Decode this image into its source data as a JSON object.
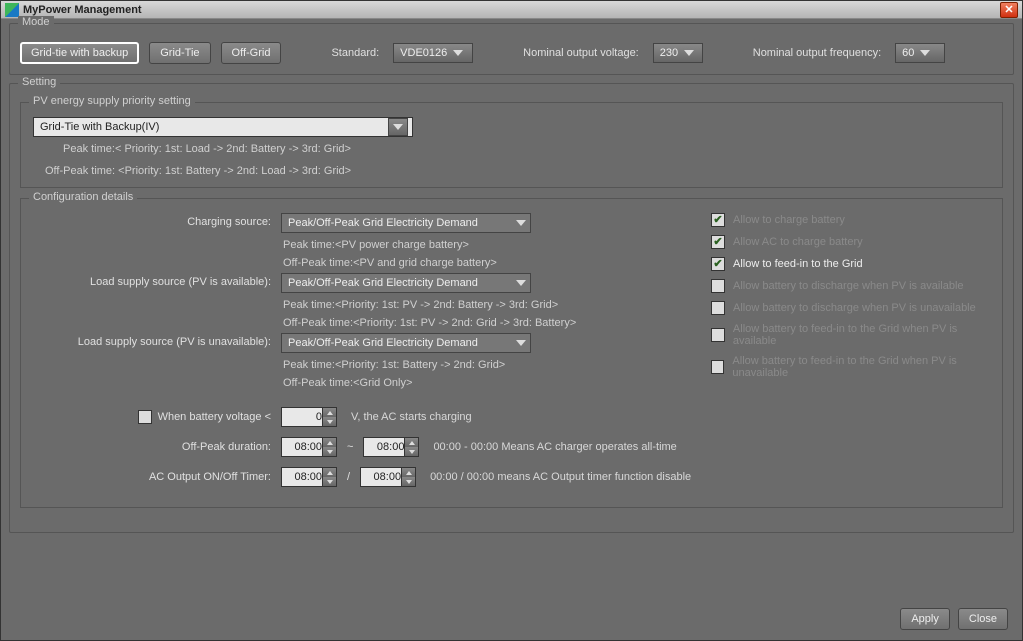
{
  "window": {
    "title": "MyPower Management"
  },
  "mode": {
    "legend": "Mode",
    "buttons": {
      "grid_tie_backup": "Grid-tie with backup",
      "grid_tie": "Grid-Tie",
      "off_grid": "Off-Grid"
    },
    "standard_label": "Standard:",
    "standard_value": "VDE0126",
    "voltage_label": "Nominal output voltage:",
    "voltage_value": "230",
    "freq_label": "Nominal output frequency:",
    "freq_value": "60"
  },
  "setting": {
    "legend": "Setting",
    "pv_priority": {
      "legend": "PV energy supply priority setting",
      "select_value": "Grid-Tie with Backup(IV)",
      "peak_hint": "Peak time:< Priority: 1st: Load -> 2nd: Battery -> 3rd: Grid>",
      "offpeak_hint": "Off-Peak time: <Priority: 1st: Battery -> 2nd: Load -> 3rd: Grid>"
    },
    "config": {
      "legend": "Configuration details",
      "charging_source_label": "Charging source:",
      "charging_source_value": "Peak/Off-Peak Grid Electricity Demand",
      "charging_peak": "Peak time:<PV power charge battery>",
      "charging_offpeak": "Off-Peak time:<PV and grid charge battery>",
      "load_avail_label": "Load supply source (PV is available):",
      "load_avail_value": "Peak/Off-Peak Grid Electricity Demand",
      "load_avail_peak": "Peak time:<Priority: 1st: PV -> 2nd: Battery -> 3rd: Grid>",
      "load_avail_offpeak": "Off-Peak time:<Priority: 1st: PV -> 2nd: Grid -> 3rd: Battery>",
      "load_unavail_label": "Load supply source (PV is unavailable):",
      "load_unavail_value": "Peak/Off-Peak Grid Electricity Demand",
      "load_unavail_peak": "Peak time:<Priority: 1st: Battery -> 2nd: Grid>",
      "load_unavail_offpeak": "Off-Peak time:<Grid Only>",
      "batt_voltage_label": "When battery voltage <",
      "batt_voltage_value": "0",
      "batt_voltage_suffix": "V,    the AC starts charging",
      "offpeak_dur_label": "Off-Peak duration:",
      "offpeak_start": "08:00",
      "offpeak_end": "08:00",
      "offpeak_sep": "~",
      "offpeak_hint": "00:00 - 00:00 Means AC charger operates all-time",
      "ac_timer_label": "AC Output ON/Off Timer:",
      "ac_timer_start": "08:00",
      "ac_timer_end": "08:00",
      "ac_timer_sep": "/",
      "ac_timer_hint": "00:00 / 00:00 means AC Output timer function disable",
      "checks": {
        "charge_batt": "Allow to charge battery",
        "ac_charge": "Allow AC to charge battery",
        "feedin": "Allow to feed-in to the Grid",
        "disch_pv_avail": "Allow battery to discharge when PV is available",
        "disch_pv_unavail": "Allow battery to discharge when PV is unavailable",
        "feedin_pv_avail": "Allow battery to feed-in to the Grid when PV is available",
        "feedin_pv_unavail": "Allow battery to feed-in to the Grid when PV is unavailable"
      }
    }
  },
  "footer": {
    "apply": "Apply",
    "close": "Close"
  }
}
